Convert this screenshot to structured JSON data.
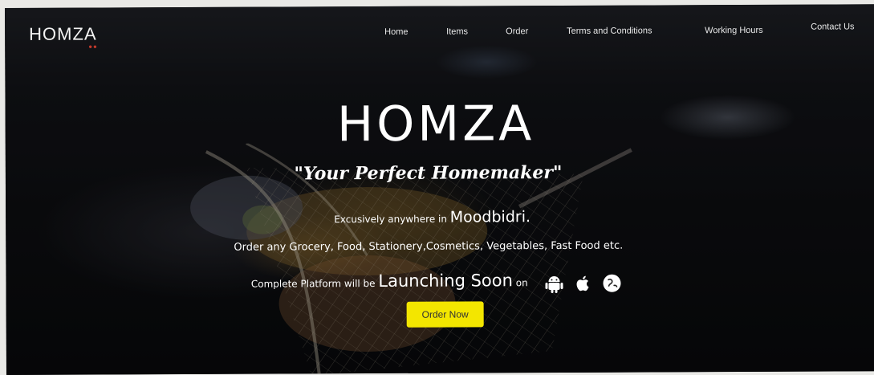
{
  "brand": {
    "logo_text": "HOMZA",
    "title": "HOMZA",
    "tagline": "\"Your Perfect Homemaker\""
  },
  "nav": {
    "items": [
      {
        "label": "Home"
      },
      {
        "label": "Items"
      },
      {
        "label": "Order"
      },
      {
        "label": "Terms and Conditions"
      },
      {
        "label": "Working Hours"
      },
      {
        "label": "Contact Us"
      }
    ]
  },
  "hero": {
    "exclusive_prefix": "Excusively anywhere in",
    "exclusive_place": "Moodbidri.",
    "order_line": "Order any Grocery, Food, Stationery,Cosmetics, Vegetables, Fast Food etc.",
    "launch_prefix": "Complete Platform will be",
    "launch_big": "Launching Soon",
    "launch_suffix": "on",
    "platform_icons": [
      "android-icon",
      "apple-icon",
      "globe-icon"
    ],
    "cta_label": "Order Now",
    "cta_color": "#f3e600"
  }
}
